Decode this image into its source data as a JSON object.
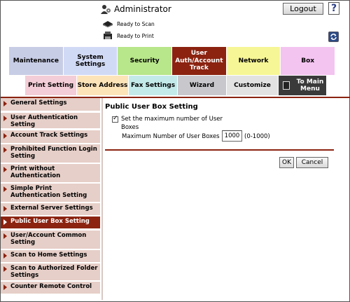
{
  "header": {
    "user_name": "Administrator",
    "logout_label": "Logout",
    "help_label": "?",
    "status_scan": "Ready to Scan",
    "status_print": "Ready to Print"
  },
  "tabs": [
    {
      "label": "Maintenance",
      "bg": "#c8cde6"
    },
    {
      "label": "System Settings",
      "bg": "#d1daf5"
    },
    {
      "label": "Security",
      "bg": "#b8e68a"
    },
    {
      "label": "User Auth/Account Track",
      "bg": "#8b2310",
      "active": true
    },
    {
      "label": "Network",
      "bg": "#f6f696"
    },
    {
      "label": "Box",
      "bg": "#f3c4f0"
    }
  ],
  "subtabs": [
    {
      "label": "Print Setting",
      "bg": "#f3cdd7"
    },
    {
      "label": "Store Address",
      "bg": "#fde3b8"
    },
    {
      "label": "Fax Settings",
      "bg": "#c3eae9"
    },
    {
      "label": "Wizard",
      "bg": "#c7c7cc"
    },
    {
      "label": "Customize",
      "bg": "#e2e2e2"
    },
    {
      "label": "To Main Menu",
      "bg": "#3a3a3a"
    }
  ],
  "sidebar": {
    "items": [
      {
        "label": "General Settings"
      },
      {
        "label": "User Authentication Setting"
      },
      {
        "label": "Account Track Settings"
      },
      {
        "label": "Prohibited Function Login Setting"
      },
      {
        "label": "Print without Authentication"
      },
      {
        "label": "Simple Print Authentication Setting"
      },
      {
        "label": "External Server Settings"
      },
      {
        "label": "Public User Box Setting",
        "active": true
      },
      {
        "label": "User/Account Common Setting"
      },
      {
        "label": "Scan to Home Settings"
      },
      {
        "label": "Scan to Authorized Folder Settings"
      },
      {
        "label": "Counter Remote Control"
      }
    ]
  },
  "content": {
    "title": "Public User Box Setting",
    "checkbox_label": "Set the maximum number of User Boxes",
    "checkbox_checked": true,
    "max_label": "Maximum Number of User Boxes",
    "max_value": "1000",
    "max_range": "(0-1000)",
    "ok_label": "OK",
    "cancel_label": "Cancel"
  }
}
